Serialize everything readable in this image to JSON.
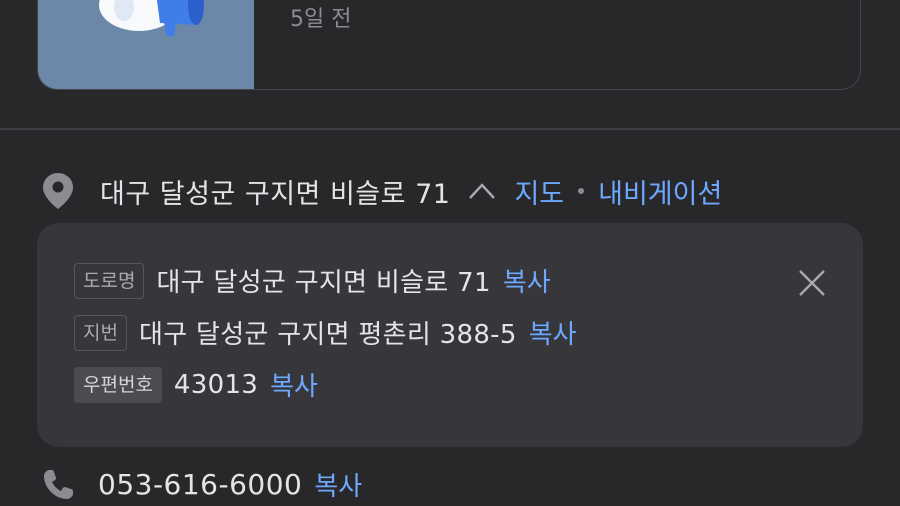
{
  "notice": {
    "time_ago": "5일 전",
    "thumbnail_icon": "megaphone-icon"
  },
  "address": {
    "main": "대구 달성군 구지면 비슬로 71",
    "map_label": "지도",
    "navigation_label": "내비게이션",
    "pin_icon": "location-pin-icon",
    "toggle_icon": "chevron-up-icon"
  },
  "detail": {
    "road": {
      "tag": "도로명",
      "value": "대구 달성군 구지면 비슬로 71",
      "copy_label": "복사"
    },
    "lot": {
      "tag": "지번",
      "value": "대구 달성군 구지면 평촌리 388-5",
      "copy_label": "복사"
    },
    "postal": {
      "tag": "우편번호",
      "value": "43013",
      "copy_label": "복사"
    },
    "close_icon": "close-icon"
  },
  "phone": {
    "number": "053-616-6000",
    "copy_label": "복사",
    "icon": "phone-icon"
  },
  "colors": {
    "background": "#28282b",
    "panel": "#37373b",
    "link": "#6ea8fe",
    "text": "#e4e4e6",
    "muted": "#8b8b91"
  }
}
